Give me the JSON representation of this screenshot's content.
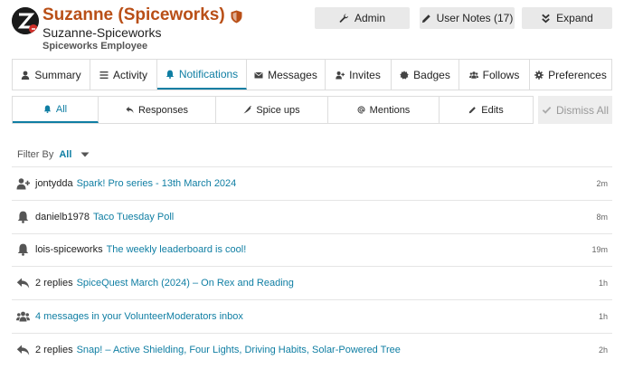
{
  "user": {
    "display_name": "Suzanne (Spiceworks)",
    "username": "Suzanne-Spiceworks",
    "subtitle": "Spiceworks Employee"
  },
  "header_buttons": {
    "admin": "Admin",
    "user_notes": "User Notes (17)",
    "expand": "Expand"
  },
  "main_tabs": [
    {
      "label": "Summary",
      "icon": "user-icon"
    },
    {
      "label": "Activity",
      "icon": "list-icon"
    },
    {
      "label": "Notifications",
      "icon": "bell-icon",
      "active": true
    },
    {
      "label": "Messages",
      "icon": "envelope-icon"
    },
    {
      "label": "Invites",
      "icon": "user-plus-icon"
    },
    {
      "label": "Badges",
      "icon": "certificate-icon"
    },
    {
      "label": "Follows",
      "icon": "users-icon"
    },
    {
      "label": "Preferences",
      "icon": "gear-icon"
    }
  ],
  "sub_tabs": [
    {
      "label": "All",
      "icon": "bell-icon",
      "active": true
    },
    {
      "label": "Responses",
      "icon": "reply-icon"
    },
    {
      "label": "Spice ups",
      "icon": "pepper-icon"
    },
    {
      "label": "Mentions",
      "icon": "at-icon"
    },
    {
      "label": "Edits",
      "icon": "pencil-icon"
    }
  ],
  "dismiss_all": "Dismiss All",
  "filter": {
    "label": "Filter By",
    "value": "All"
  },
  "notifications": [
    {
      "icon": "user-plus-icon",
      "prefix": "jontydda",
      "link": "Spark! Pro series - 13th March 2024",
      "time": "2m"
    },
    {
      "icon": "bell-icon",
      "prefix": "danielb1978",
      "link": "Taco Tuesday Poll",
      "time": "8m"
    },
    {
      "icon": "bell-icon",
      "prefix": "lois-spiceworks",
      "link": "The weekly leaderboard is cool!",
      "time": "19m"
    },
    {
      "icon": "reply-icon",
      "prefix": "2 replies",
      "link": "SpiceQuest March (2024) – On Rex and Reading",
      "time": "1h"
    },
    {
      "icon": "users-icon",
      "prefix": "",
      "link": "4 messages in your VolunteerModerators inbox",
      "time": "1h"
    },
    {
      "icon": "reply-icon",
      "prefix": "2 replies",
      "link": "Snap! – Active Shielding, Four Lights, Driving Habits, Solar-Powered Tree",
      "time": "2h"
    }
  ],
  "colors": {
    "accent": "#0f7ea3",
    "title": "#b94f17"
  }
}
